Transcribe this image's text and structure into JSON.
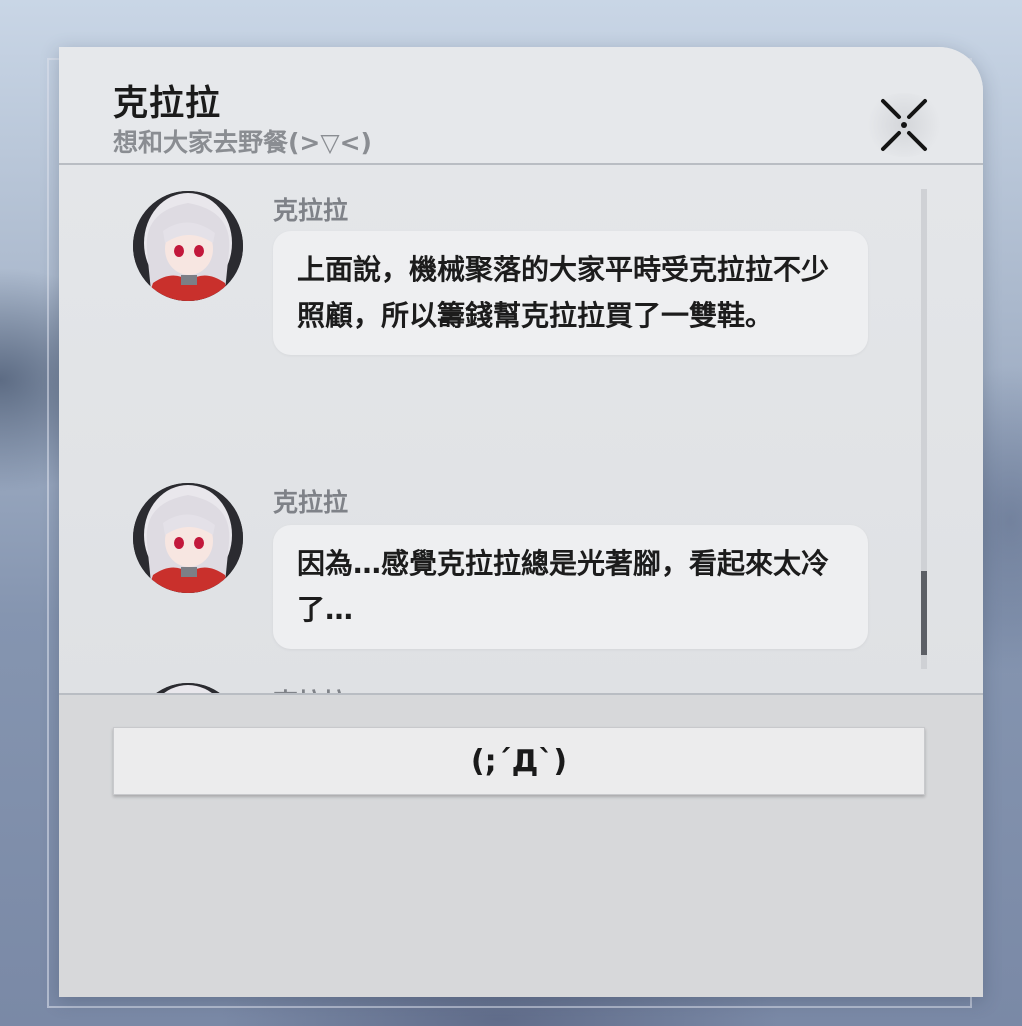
{
  "dialog": {
    "title": "克拉拉",
    "subtitle": "想和大家去野餐(>▽<)",
    "close_icon": "close-x-icon"
  },
  "messages": [
    {
      "sender": "克拉拉",
      "text": "上面說，機械聚落的大家平時受克拉拉不少照顧，所以籌錢幫克拉拉買了一雙鞋。"
    },
    {
      "sender": "克拉拉",
      "text": "因為…感覺克拉拉總是光著腳，看起來太冷了…"
    },
    {
      "sender": "克拉拉",
      "text": ""
    }
  ],
  "reply": {
    "option_label": "(;´Д`)"
  },
  "colors": {
    "panel": "#e3e5e8",
    "bubble": "#eeeff1",
    "footer": "#d7d8da",
    "scroll_thumb": "#5c5f65"
  }
}
